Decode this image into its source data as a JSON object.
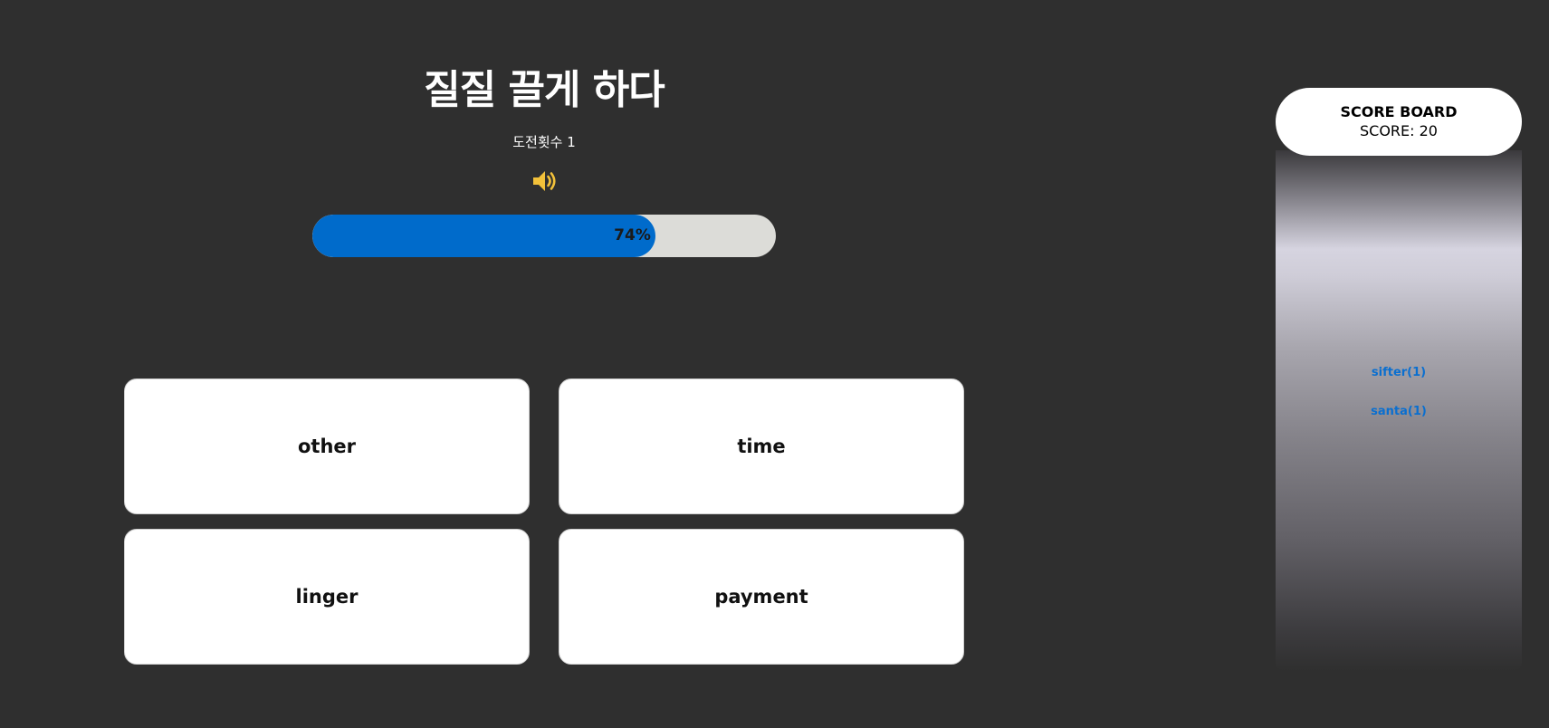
{
  "question": {
    "word": "질질 끌게 하다",
    "attempts_label": "도전횟수 1",
    "speaker_icon": "speaker-volume-icon",
    "progress_percent": 74,
    "progress_label": "74%"
  },
  "answers": [
    {
      "label": "other"
    },
    {
      "label": "time"
    },
    {
      "label": "linger"
    },
    {
      "label": "payment"
    }
  ],
  "scoreboard": {
    "title": "SCORE BOARD",
    "score_label": "SCORE: 20",
    "players": [
      {
        "label": "sifter(1)"
      },
      {
        "label": "santa(1)"
      }
    ]
  },
  "colors": {
    "background": "#2f2f2f",
    "progress_fill": "#006bcb",
    "progress_track": "#dcdcd8",
    "speaker": "#f2c13a",
    "player_text": "#0a6fd0"
  }
}
